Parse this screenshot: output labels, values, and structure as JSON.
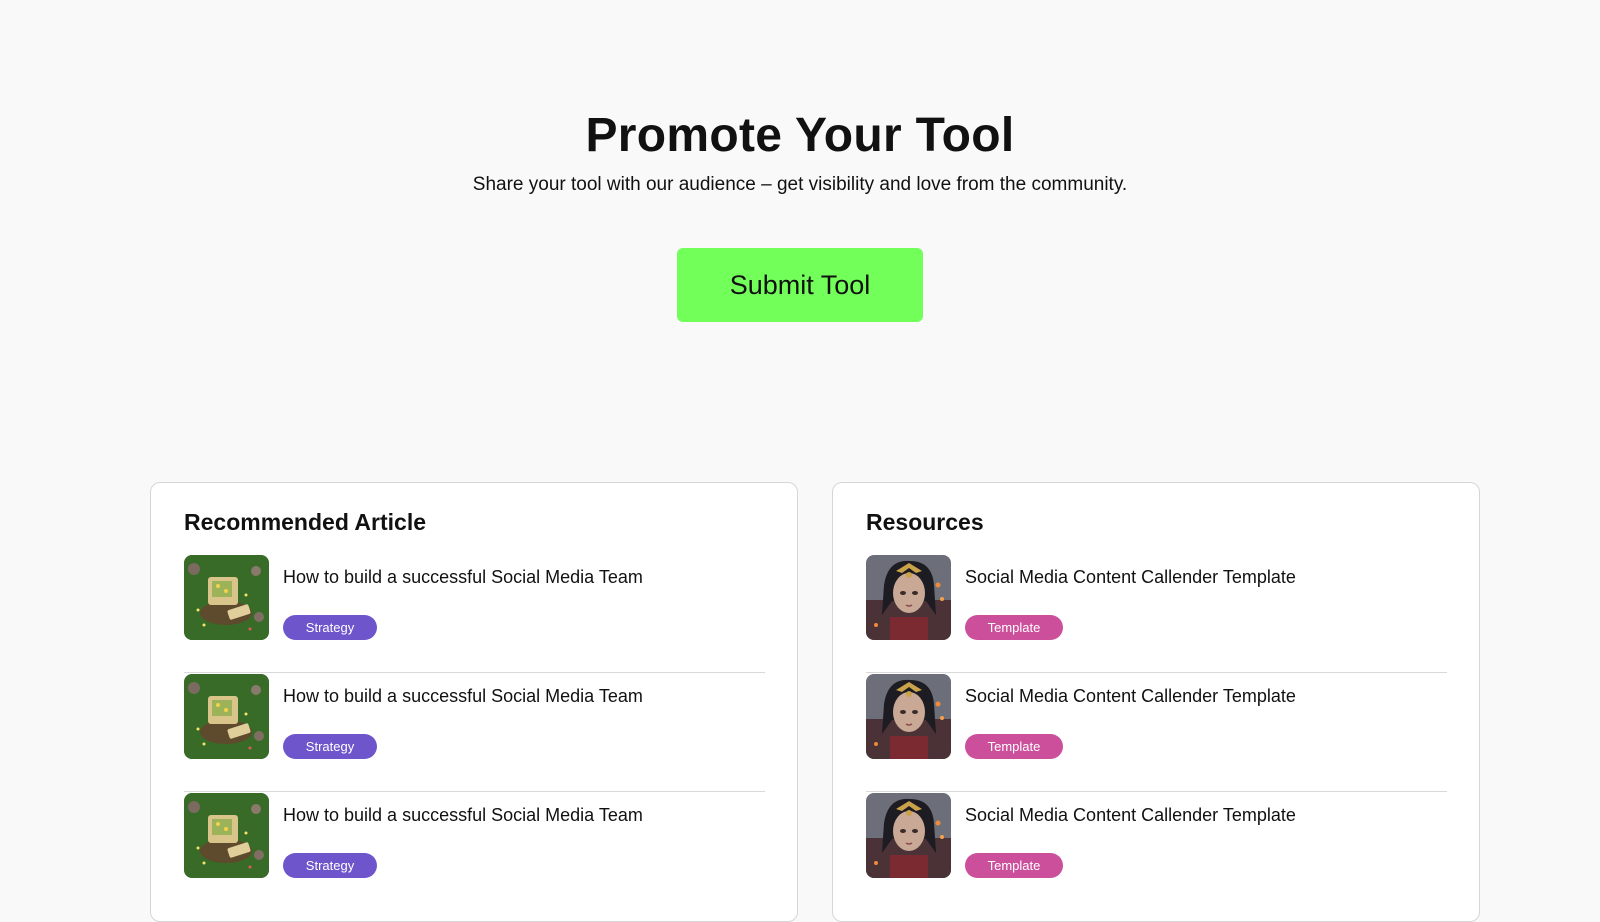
{
  "hero": {
    "title": "Promote Your Tool",
    "subtitle": "Share your tool with our audience – get visibility and love from the community.",
    "button_label": "Submit Tool",
    "button_color": "#72ff5a"
  },
  "recommended": {
    "title": "Recommended Article",
    "badge_color": "#6e55cc",
    "items": [
      {
        "title": "How to build a successful Social Media Team",
        "badge": "Strategy",
        "thumb_icon": "retro-computer-garden-icon"
      },
      {
        "title": "How to build a successful Social Media Team",
        "badge": "Strategy",
        "thumb_icon": "retro-computer-garden-icon"
      },
      {
        "title": "How to build a successful Social Media Team",
        "badge": "Strategy",
        "thumb_icon": "retro-computer-garden-icon"
      }
    ]
  },
  "resources": {
    "title": "Resources",
    "badge_color": "#cc4f9b",
    "items": [
      {
        "title": "Social Media Content Callender Template",
        "badge": "Template",
        "thumb_icon": "warrior-portrait-icon"
      },
      {
        "title": "Social Media Content Callender Template",
        "badge": "Template",
        "thumb_icon": "warrior-portrait-icon"
      },
      {
        "title": "Social Media Content Callender Template",
        "badge": "Template",
        "thumb_icon": "warrior-portrait-icon"
      }
    ]
  }
}
